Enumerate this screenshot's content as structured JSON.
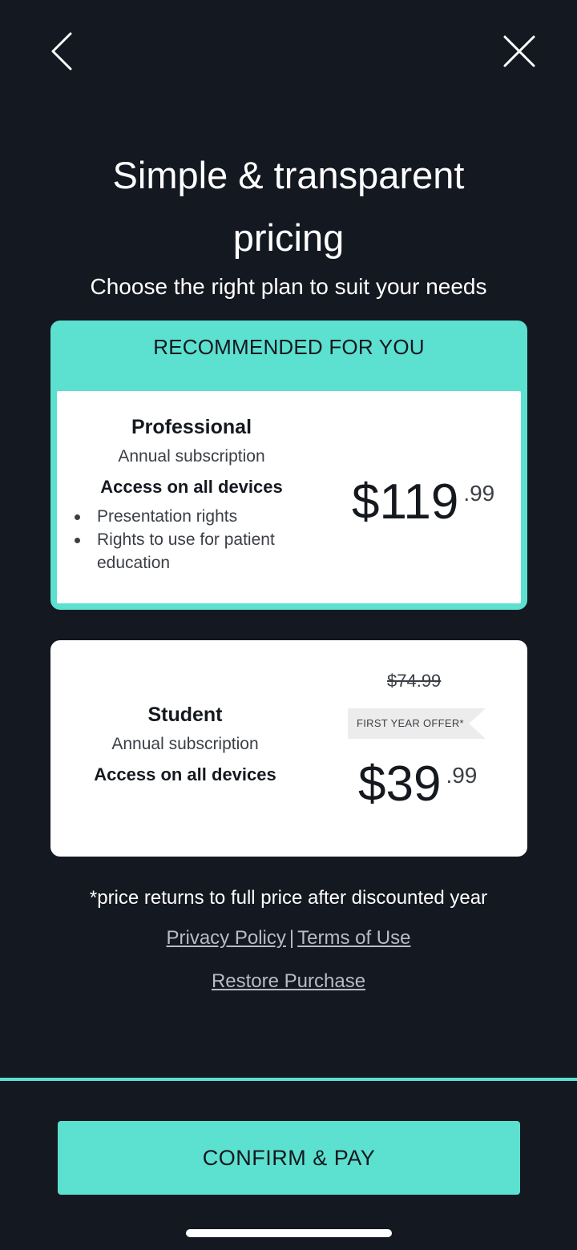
{
  "nav": {
    "back_icon": "chevron-left-icon",
    "close_icon": "close-icon"
  },
  "header": {
    "title_line1": "Simple & transparent",
    "title_line2": "pricing",
    "subtitle": "Choose the right plan to suit your needs"
  },
  "plans": [
    {
      "banner": "RECOMMENDED FOR YOU",
      "name": "Professional",
      "term": "Annual subscription",
      "access": "Access on all devices",
      "features": [
        "Presentation rights",
        "Rights to use for patient education"
      ],
      "price_main": "$119",
      "price_cents": ".99",
      "selected": true
    },
    {
      "name": "Student",
      "term": "Annual subscription",
      "access": "Access on all devices",
      "old_price": "$74.99",
      "offer": "FIRST YEAR OFFER*",
      "price_main": "$39",
      "price_cents": ".99",
      "selected": false
    }
  ],
  "footer": {
    "disclaimer": "*price returns to full price after discounted year",
    "privacy": "Privacy Policy",
    "separator": "|",
    "terms": "Terms of Use",
    "restore": "Restore Purchase",
    "confirm": "CONFIRM & PAY"
  },
  "colors": {
    "background": "#141820",
    "accent": "#5ce0cf",
    "card": "#ffffff"
  }
}
